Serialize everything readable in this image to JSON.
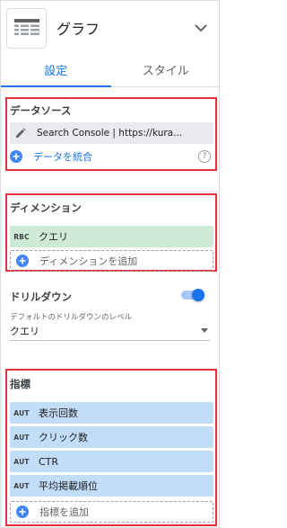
{
  "header": {
    "title": "グラフ",
    "chart_icon": "table-chart-icon",
    "chevron_icon": "chevron-down-icon"
  },
  "tabs": [
    {
      "label": "設定",
      "active": true
    },
    {
      "label": "スタイル",
      "active": false
    }
  ],
  "data_source": {
    "title": "データソース",
    "source_name": "Search Console | https://kura...",
    "blend_label": "データを統合",
    "help": "?"
  },
  "dimension": {
    "title": "ディメンション",
    "items": [
      {
        "badge": "RBC",
        "label": "クエリ"
      }
    ],
    "add_label": "ディメンションを追加"
  },
  "drilldown": {
    "title": "ドリルダウン",
    "enabled": true,
    "sub_label": "デフォルトのドリルダウンのレベル",
    "selected": "クエリ"
  },
  "metrics": {
    "title": "指標",
    "items": [
      {
        "badge": "AUT",
        "label": "表示回数"
      },
      {
        "badge": "AUT",
        "label": "クリック数"
      },
      {
        "badge": "AUT",
        "label": "CTR"
      },
      {
        "badge": "AUT",
        "label": "平均掲載順位"
      }
    ],
    "add_label": "指標を追加"
  },
  "colors": {
    "accent": "#1a73e8",
    "highlight_border": "#e8303a",
    "dimension_chip": "#ceead6",
    "metric_chip": "#c2ddf8"
  }
}
